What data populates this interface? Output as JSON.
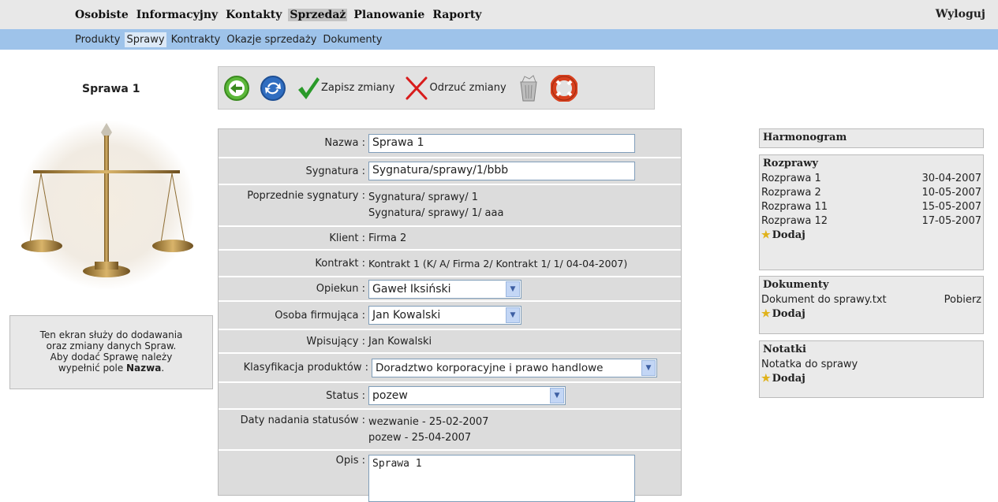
{
  "top_nav": {
    "items": [
      "Osobiste",
      "Informacyjny",
      "Kontakty",
      "Sprzedaż",
      "Planowanie",
      "Raporty"
    ],
    "active": "Sprzedaż",
    "logout": "Wyloguj"
  },
  "sub_nav": {
    "items": [
      "Produkty",
      "Sprawy",
      "Kontrakty",
      "Okazje sprzedaży",
      "Dokumenty"
    ],
    "active": "Sprawy"
  },
  "page_title": "Sprawa 1",
  "info": {
    "line1": "Ten ekran służy do dodawania",
    "line2": "oraz zmiany danych Spraw.",
    "line3": "Aby dodać Sprawę należy",
    "line4_pre": "wypełnić pole ",
    "line4_bold": "Nazwa",
    "line4_post": "."
  },
  "toolbar": {
    "save_label": "Zapisz zmiany",
    "discard_label": "Odrzuć zmiany"
  },
  "form": {
    "nazwa_label": "Nazwa :",
    "nazwa_value": "Sprawa 1",
    "sygnatura_label": "Sygnatura :",
    "sygnatura_value": "Sygnatura/sprawy/1/bbb",
    "poprzednie_label": "Poprzednie sygnatury :",
    "poprzednie_1": "Sygnatura/ sprawy/ 1",
    "poprzednie_2": "Sygnatura/ sprawy/ 1/ aaa",
    "klient_label": "Klient :",
    "klient_value": "Firma 2",
    "kontrakt_label": "Kontrakt :",
    "kontrakt_value": "Kontrakt 1 (K/ A/ Firma 2/ Kontrakt 1/ 1/ 04-04-2007)",
    "opiekun_label": "Opiekun :",
    "opiekun_value": "Gaweł Iksiński",
    "osoba_label": "Osoba firmująca :",
    "osoba_value": "Jan Kowalski",
    "wpisujacy_label": "Wpisujący :",
    "wpisujacy_value": "Jan Kowalski",
    "klasyfikacja_label": "Klasyfikacja produktów :",
    "klasyfikacja_value": "Doradztwo korporacyjne i prawo handlowe",
    "status_label": "Status :",
    "status_value": "pozew",
    "daty_label": "Daty nadania statusów :",
    "daty_1": "wezwanie - 25-02-2007",
    "daty_2": "pozew - 25-04-2007",
    "opis_label": "Opis :",
    "opis_value": "Sprawa 1"
  },
  "side": {
    "harmonogram": "Harmonogram",
    "rozprawy_title": "Rozprawy",
    "rozprawy": [
      {
        "name": "Rozprawa 1",
        "date": "30-04-2007"
      },
      {
        "name": "Rozprawa 2",
        "date": "10-05-2007"
      },
      {
        "name": "Rozprawa 11",
        "date": "15-05-2007"
      },
      {
        "name": "Rozprawa 12",
        "date": "17-05-2007"
      }
    ],
    "dokumenty_title": "Dokumenty",
    "dokument_name": "Dokument do sprawy.txt",
    "dokument_action": "Pobierz",
    "notatki_title": "Notatki",
    "notatka": "Notatka do sprawy",
    "add_label": "Dodaj"
  },
  "colors": {
    "topbar": "#e8e8e8",
    "subbar": "#9ec3ea",
    "save_green": "#2a9a2a",
    "discard_red": "#d81c1c",
    "star": "#e0b21a"
  }
}
